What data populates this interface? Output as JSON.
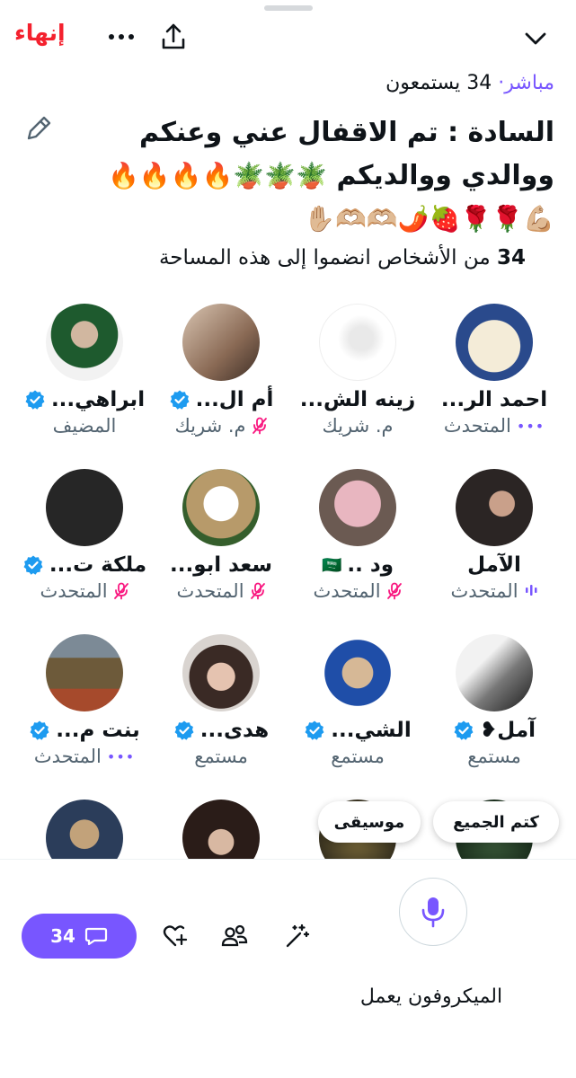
{
  "header": {
    "end_label": "إنهاء",
    "more_icon": "more-horizontal-icon",
    "share_icon": "share-icon",
    "collapse_icon": "chevron-down-icon"
  },
  "status": {
    "live": "مباشر·",
    "listeners": "34 يستمعون"
  },
  "space": {
    "title": "السادة : تم الاقفال عني وعنكم ووالدي ووالديكم",
    "title_emojis_1": "🪴🪴🪴🔥🔥🔥🔥",
    "title_emojis_2": "💪🏼🌹🌹🍓🌶️🫶🏼🫶🏼✋🏼",
    "edit_icon": "pencil-icon"
  },
  "joined": {
    "count": "34",
    "text": "من الأشخاص انضموا إلى هذه المساحة"
  },
  "participants": [
    {
      "name": "احمد الر...",
      "role": "المتحدث",
      "verified": false,
      "indicator": "dots",
      "avatar": "calligraphy"
    },
    {
      "name": "زينه الش...",
      "role": "م. شريك",
      "verified": false,
      "indicator": "none",
      "avatar": "horse-sketch"
    },
    {
      "name": "أم ال...",
      "role": "م. شريك",
      "verified": true,
      "indicator": "muted",
      "avatar": "coffee-scene"
    },
    {
      "name": "ابراهي...",
      "role": "المضيف",
      "verified": true,
      "indicator": "none",
      "avatar": "man-sunglasses"
    },
    {
      "name": "الآمل",
      "role": "المتحدث",
      "verified": false,
      "indicator": "speaking",
      "avatar": "woman-portrait"
    },
    {
      "name": "ود ..",
      "role": "المتحدث",
      "verified": false,
      "indicator": "muted",
      "flag": "🇸🇦",
      "avatar": "roses-bouquet"
    },
    {
      "name": "سعد ابو...",
      "role": "المتحدث",
      "verified": false,
      "indicator": "muted",
      "avatar": "man-ghutra"
    },
    {
      "name": "ملكة ت...",
      "role": "المتحدث",
      "verified": true,
      "indicator": "muted",
      "avatar": "dark-text"
    },
    {
      "name": "آمل❥",
      "role": "مستمع",
      "verified": true,
      "indicator": "none",
      "avatar": "bw-woman"
    },
    {
      "name": "الشي...",
      "role": "مستمع",
      "verified": true,
      "indicator": "none",
      "avatar": "blue-crest"
    },
    {
      "name": "هدى...",
      "role": "مستمع",
      "verified": true,
      "indicator": "none",
      "avatar": "woman-bangs"
    },
    {
      "name": "بنت م...",
      "role": "المتحدث",
      "verified": true,
      "indicator": "dots",
      "avatar": "picnic"
    },
    {
      "name": "",
      "role": "",
      "verified": false,
      "indicator": "none",
      "avatar": "green-dark"
    },
    {
      "name": "",
      "role": "",
      "verified": false,
      "indicator": "none",
      "avatar": "dark-gold"
    },
    {
      "name": "",
      "role": "",
      "verified": false,
      "indicator": "none",
      "avatar": "woman-dark-hair"
    },
    {
      "name": "",
      "role": "",
      "verified": false,
      "indicator": "none",
      "avatar": "kings"
    }
  ],
  "actions": {
    "mute_all": "كتم الجميع",
    "music": "موسيقى"
  },
  "bottom": {
    "comments_count": "34",
    "comment_icon": "chat-bubble-icon",
    "like_icon": "heart-plus-icon",
    "people_icon": "people-icon",
    "effects_icon": "magic-wand-icon",
    "mic_icon": "microphone-icon",
    "mic_label": "الميكروفون يعمل"
  },
  "colors": {
    "accent": "#7856ff",
    "end": "#f4212e",
    "verified": "#1d9bf0",
    "muted_mic": "#f91880"
  }
}
